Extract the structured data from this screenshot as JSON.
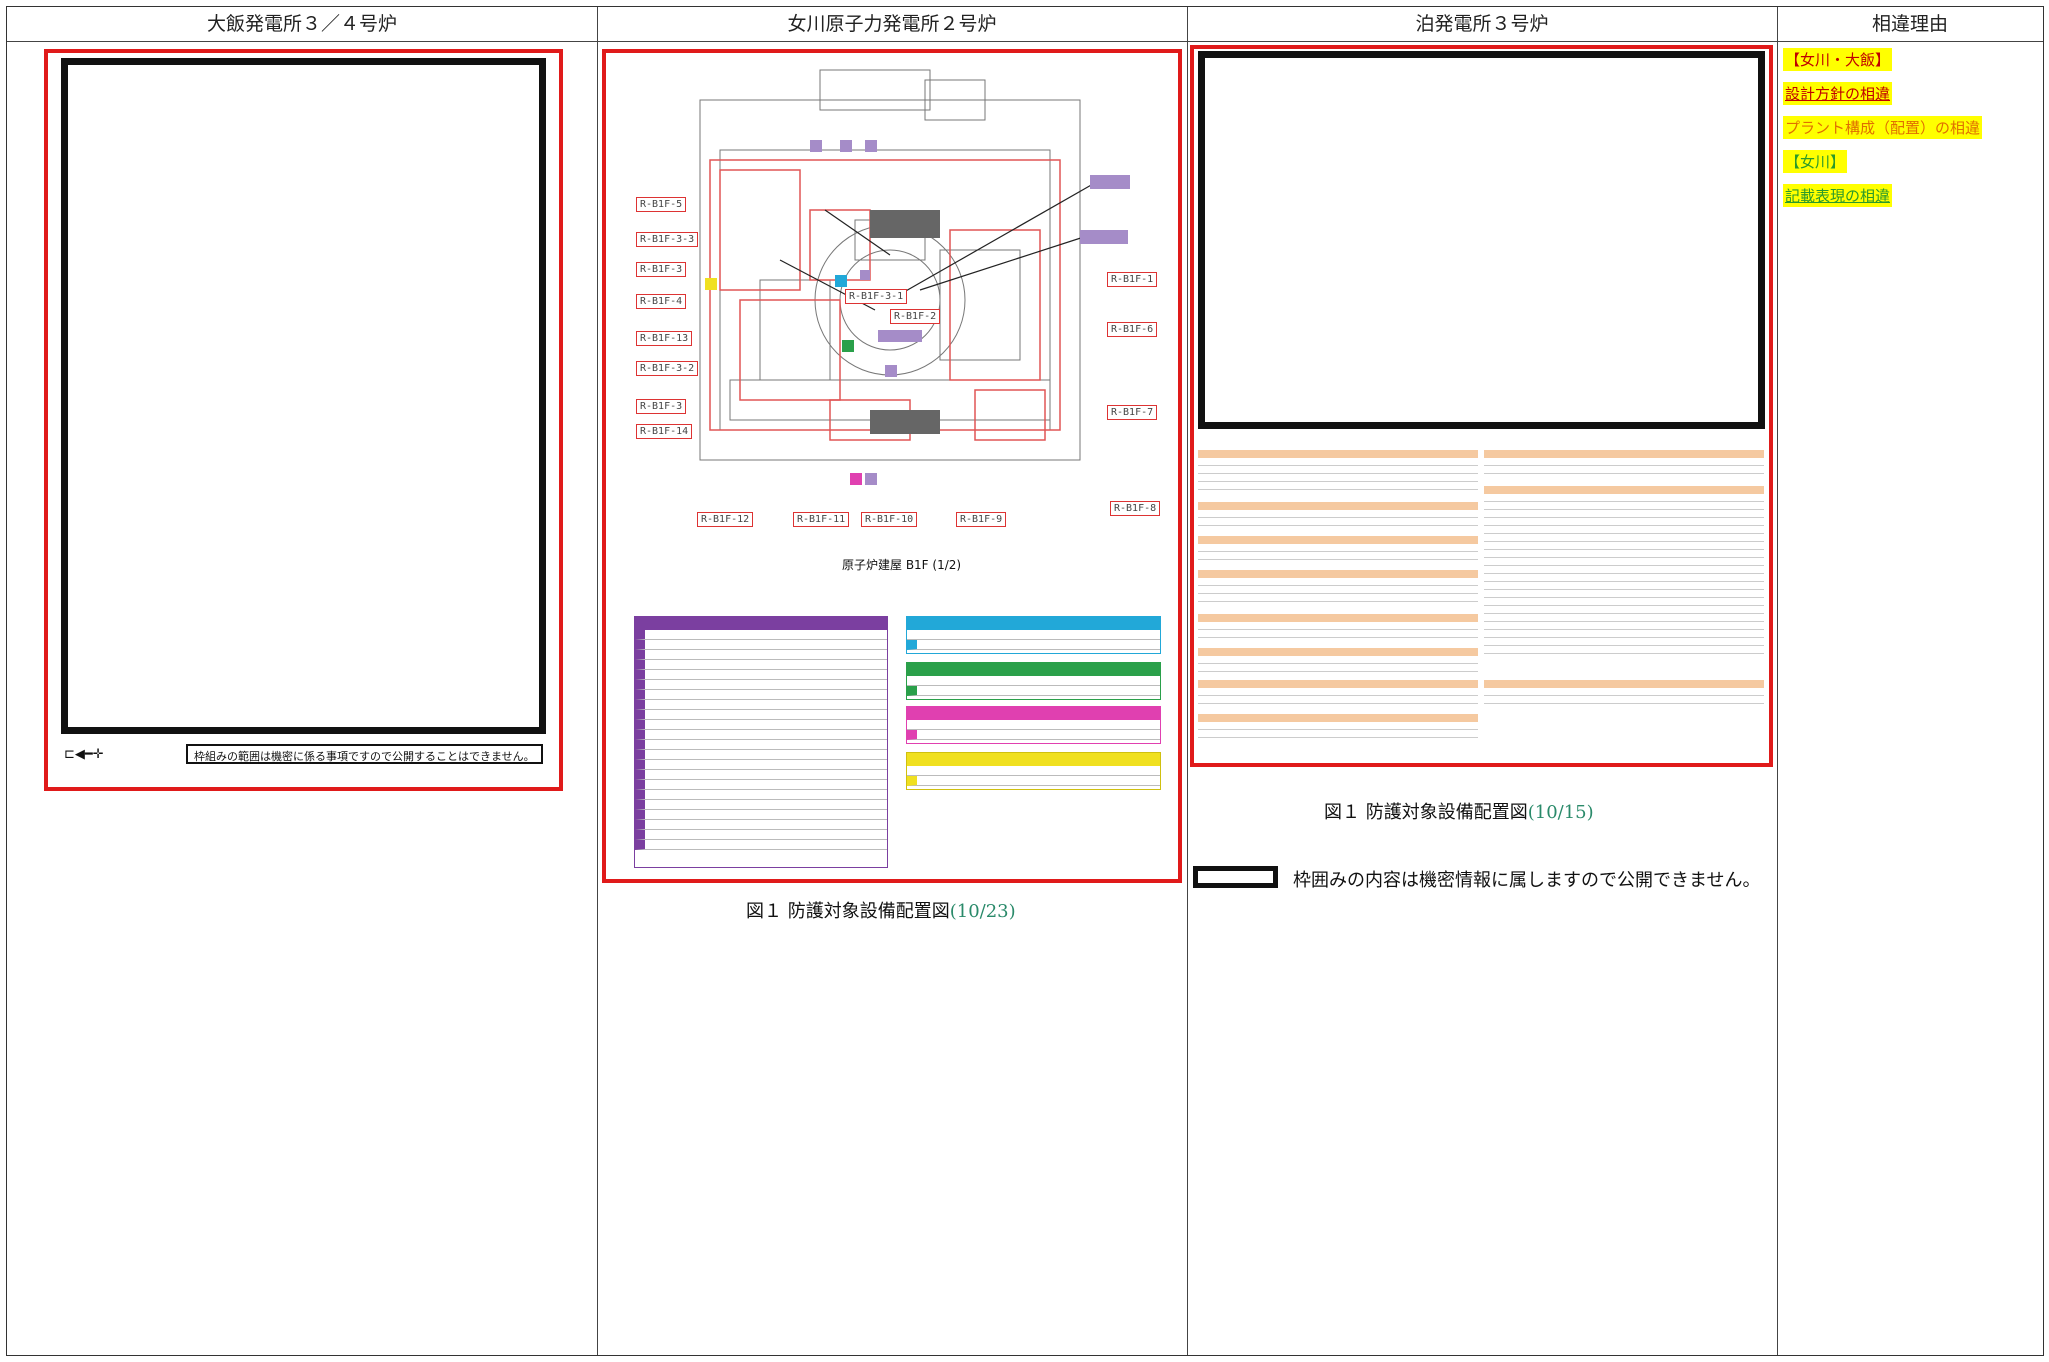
{
  "headers": {
    "col1": "大飯発電所３／４号炉",
    "col2": "女川原子力発電所２号炉",
    "col3": "泊発電所３号炉",
    "col4": "相違理由"
  },
  "col1": {
    "redacted_note": "枠組みの範囲は機密に係る事項ですので公開することはできません。"
  },
  "col2": {
    "drawing_title": "原子炉建屋 B1F (1/2)",
    "caption_prefix": "図１ 防護対象設備配置図",
    "caption_num": "(10/23)",
    "room_labels": [
      "R-B1F-5",
      "R-B1F-3-3",
      "R-B1F-3",
      "R-B1F-4",
      "R-B1F-13",
      "R-B1F-3-2",
      "R-B1F-3",
      "R-B1F-14",
      "R-B1F-12",
      "R-B1F-11",
      "R-B1F-10",
      "R-B1F-9",
      "R-B1F-8",
      "R-B1F-7",
      "R-B1F-6",
      "R-B1F-1",
      "R-B1F-3-1",
      "R-B1F-2"
    ],
    "legend_colors": {
      "purple": "#7b3fa0",
      "cyan": "#22a8d8",
      "green": "#2aa04a",
      "magenta": "#e040b0",
      "yellow": "#f0e020",
      "lavender": "#a58cc8"
    }
  },
  "col3": {
    "caption_prefix": "図１ 防護対象設備配置図",
    "caption_num": "(10/15)",
    "redacted_note": "枠囲みの内容は機密情報に属しますので公開できません。"
  },
  "col4": {
    "tags": [
      "【女川・大飯】",
      "設計方針の相違",
      "プラント構成（配置）の相違",
      "【女川】",
      "記載表現の相違"
    ]
  }
}
